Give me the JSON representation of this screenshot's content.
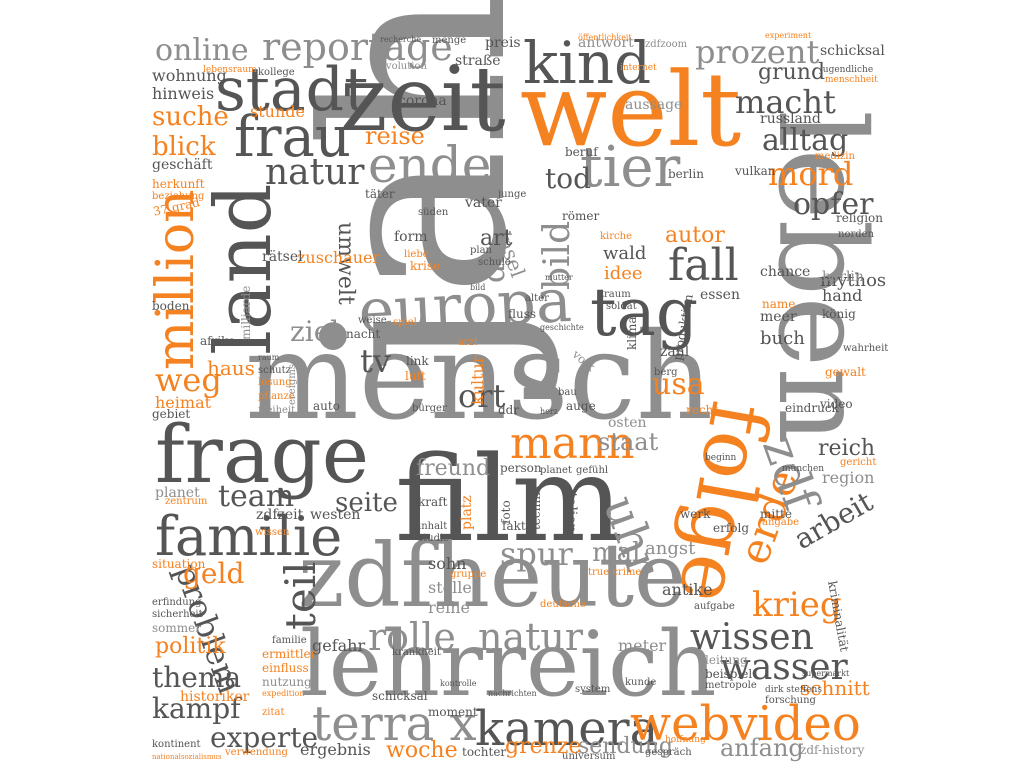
{
  "palette": {
    "dark": "#555555",
    "gray": "#8e8e8e",
    "orange": "#f58220",
    "light": "#a8a8a8"
  },
  "words": [
    {
      "text": "jahr",
      "color": "gray"
    },
    {
      "text": "leben",
      "color": "gray"
    },
    {
      "text": "mensch",
      "color": "gray"
    },
    {
      "text": "welt",
      "color": "orange"
    },
    {
      "text": "film",
      "color": "dark"
    },
    {
      "text": "zeit",
      "color": "dark"
    },
    {
      "text": "zdfheute",
      "color": "gray"
    },
    {
      "text": "lehrreich",
      "color": "gray"
    },
    {
      "text": "frage",
      "color": "dark"
    },
    {
      "text": "land",
      "color": "dark"
    },
    {
      "text": "folge",
      "color": "orange"
    },
    {
      "text": "europa",
      "color": "gray"
    },
    {
      "text": "tag",
      "color": "dark"
    },
    {
      "text": "kind",
      "color": "dark"
    },
    {
      "text": "stadt",
      "color": "dark"
    },
    {
      "text": "frau",
      "color": "dark"
    },
    {
      "text": "familie",
      "color": "dark"
    },
    {
      "text": "kamera",
      "color": "dark"
    },
    {
      "text": "webvideo",
      "color": "orange"
    },
    {
      "text": "terra x",
      "color": "gray"
    },
    {
      "text": "million",
      "color": "orange"
    },
    {
      "text": "ende",
      "color": "gray"
    },
    {
      "text": "tier",
      "color": "gray"
    },
    {
      "text": "reportage",
      "color": "gray"
    },
    {
      "text": "online",
      "color": "gray"
    },
    {
      "text": "prozent",
      "color": "gray"
    },
    {
      "text": "macht",
      "color": "dark"
    },
    {
      "text": "alltag",
      "color": "dark"
    },
    {
      "text": "mord",
      "color": "orange"
    },
    {
      "text": "natur",
      "color": "dark"
    },
    {
      "text": "reise",
      "color": "orange"
    },
    {
      "text": "tod",
      "color": "dark"
    },
    {
      "text": "opfer",
      "color": "dark"
    },
    {
      "text": "fall",
      "color": "dark"
    },
    {
      "text": "autor",
      "color": "orange"
    },
    {
      "text": "idee",
      "color": "orange"
    },
    {
      "text": "wald",
      "color": "dark"
    },
    {
      "text": "mythos",
      "color": "dark"
    },
    {
      "text": "teil",
      "color": "dark"
    },
    {
      "text": "problem",
      "color": "dark"
    },
    {
      "text": "geld",
      "color": "orange"
    },
    {
      "text": "team",
      "color": "dark"
    },
    {
      "text": "seite",
      "color": "dark"
    },
    {
      "text": "thema",
      "color": "dark"
    },
    {
      "text": "kampf",
      "color": "dark"
    },
    {
      "text": "experte",
      "color": "dark"
    },
    {
      "text": "rolle",
      "color": "gray"
    },
    {
      "text": "natur",
      "color": "gray"
    },
    {
      "text": "wissen",
      "color": "dark"
    },
    {
      "text": "wasser",
      "color": "dark"
    },
    {
      "text": "krieg",
      "color": "orange"
    },
    {
      "text": "arbeit",
      "color": "dark"
    },
    {
      "text": "erde",
      "color": "orange"
    },
    {
      "text": "spur",
      "color": "gray"
    },
    {
      "text": "mal",
      "color": "gray"
    },
    {
      "text": "mann",
      "color": "orange"
    },
    {
      "text": "usa",
      "color": "orange"
    },
    {
      "text": "weg",
      "color": "orange"
    },
    {
      "text": "grund",
      "color": "dark"
    },
    {
      "text": "zdf",
      "color": "gray"
    },
    {
      "text": "uhr",
      "color": "gray"
    },
    {
      "text": "schnitt",
      "color": "orange"
    },
    {
      "text": "woche",
      "color": "orange"
    },
    {
      "text": "grenze",
      "color": "orange"
    },
    {
      "text": "sendung",
      "color": "gray"
    },
    {
      "text": "anfang",
      "color": "gray"
    },
    {
      "text": "ergebnis",
      "color": "dark"
    },
    {
      "text": "suche",
      "color": "orange"
    },
    {
      "text": "blick",
      "color": "orange"
    },
    {
      "text": "ort",
      "color": "dark"
    },
    {
      "text": "bild",
      "color": "gray"
    },
    {
      "text": "tv",
      "color": "dark"
    },
    {
      "text": "dr",
      "color": "gray"
    },
    {
      "text": "insel",
      "color": "gray"
    },
    {
      "text": "art",
      "color": "dark"
    },
    {
      "text": "ziel",
      "color": "gray"
    },
    {
      "text": "umwelt",
      "color": "dark"
    },
    {
      "text": "freund",
      "color": "gray"
    },
    {
      "text": "staat",
      "color": "gray"
    },
    {
      "text": "reich",
      "color": "dark"
    },
    {
      "text": "region",
      "color": "gray"
    },
    {
      "text": "zuschauer",
      "color": "orange"
    },
    {
      "text": "heimat",
      "color": "orange"
    },
    {
      "text": "haus",
      "color": "orange"
    },
    {
      "text": "politik",
      "color": "orange"
    },
    {
      "text": "historiker",
      "color": "orange"
    },
    {
      "text": "ermittler",
      "color": "orange"
    },
    {
      "text": "einfluss",
      "color": "orange"
    },
    {
      "text": "wohnung",
      "color": "dark"
    },
    {
      "text": "hinweis",
      "color": "dark"
    },
    {
      "text": "geschäft",
      "color": "dark"
    },
    {
      "text": "herkunft",
      "color": "orange"
    },
    {
      "text": "beziehung",
      "color": "orange"
    },
    {
      "text": "37 grad",
      "color": "orange"
    },
    {
      "text": "rätsel",
      "color": "dark"
    },
    {
      "text": "boden",
      "color": "dark"
    },
    {
      "text": "afrika",
      "color": "dark"
    },
    {
      "text": "gebiet",
      "color": "dark"
    },
    {
      "text": "planet",
      "color": "gray"
    },
    {
      "text": "zdfzeit",
      "color": "dark"
    },
    {
      "text": "westen",
      "color": "dark"
    },
    {
      "text": "situation",
      "color": "orange"
    },
    {
      "text": "erfindung",
      "color": "dark"
    },
    {
      "text": "sicherheit",
      "color": "dark"
    },
    {
      "text": "sommer",
      "color": "gray"
    },
    {
      "text": "kontinent",
      "color": "dark"
    },
    {
      "text": "verwendung",
      "color": "orange"
    },
    {
      "text": "nationalsozialismus",
      "color": "orange"
    },
    {
      "text": "sohn",
      "color": "dark"
    },
    {
      "text": "stelle",
      "color": "gray"
    },
    {
      "text": "reihe",
      "color": "gray"
    },
    {
      "text": "gefahr",
      "color": "dark"
    },
    {
      "text": "familie",
      "color": "dark"
    },
    {
      "text": "nutzung",
      "color": "gray"
    },
    {
      "text": "schicksal",
      "color": "dark"
    },
    {
      "text": "moment",
      "color": "dark"
    },
    {
      "text": "tochter",
      "color": "dark"
    },
    {
      "text": "system",
      "color": "dark"
    },
    {
      "text": "kunde",
      "color": "dark"
    },
    {
      "text": "metropole",
      "color": "dark"
    },
    {
      "text": "beispiel",
      "color": "dark"
    },
    {
      "text": "leitung",
      "color": "gray"
    },
    {
      "text": "meter",
      "color": "gray"
    },
    {
      "text": "angst",
      "color": "gray"
    },
    {
      "text": "antike",
      "color": "dark"
    },
    {
      "text": "werk",
      "color": "dark"
    },
    {
      "text": "erfolg",
      "color": "dark"
    },
    {
      "text": "mitte",
      "color": "dark"
    },
    {
      "text": "aufgabe",
      "color": "dark"
    },
    {
      "text": "forschung",
      "color": "dark"
    },
    {
      "text": "gespräch",
      "color": "dark"
    },
    {
      "text": "universum",
      "color": "dark"
    },
    {
      "text": "zdf-history",
      "color": "gray"
    },
    {
      "text": "hoffnung",
      "color": "orange"
    },
    {
      "text": "kriminalität",
      "color": "dark"
    },
    {
      "text": "gericht",
      "color": "orange"
    },
    {
      "text": "angabe",
      "color": "orange"
    },
    {
      "text": "video",
      "color": "dark"
    },
    {
      "text": "eindruck",
      "color": "dark"
    },
    {
      "text": "gewalt",
      "color": "orange"
    },
    {
      "text": "wahrheit",
      "color": "dark"
    },
    {
      "text": "buch",
      "color": "dark"
    },
    {
      "text": "meer",
      "color": "dark"
    },
    {
      "text": "hand",
      "color": "dark"
    },
    {
      "text": "könig",
      "color": "dark"
    },
    {
      "text": "berlin",
      "color": "gray"
    },
    {
      "text": "chance",
      "color": "dark"
    },
    {
      "text": "name",
      "color": "orange"
    },
    {
      "text": "essen",
      "color": "dark"
    },
    {
      "text": "norden",
      "color": "dark"
    },
    {
      "text": "religion",
      "color": "dark"
    },
    {
      "text": "zahl",
      "color": "dark"
    },
    {
      "text": "klima",
      "color": "dark"
    },
    {
      "text": "recht",
      "color": "orange"
    },
    {
      "text": "berg",
      "color": "dark"
    },
    {
      "text": "volk",
      "color": "gray"
    },
    {
      "text": "produktion",
      "color": "dark"
    },
    {
      "text": "auto",
      "color": "dark"
    },
    {
      "text": "bürger",
      "color": "dark"
    },
    {
      "text": "auge",
      "color": "dark"
    },
    {
      "text": "ddr",
      "color": "dark"
    },
    {
      "text": "kultur",
      "color": "orange"
    },
    {
      "text": "luft",
      "color": "orange"
    },
    {
      "text": "ereignis",
      "color": "gray"
    },
    {
      "text": "freiheit",
      "color": "gray"
    },
    {
      "text": "lösung",
      "color": "orange"
    },
    {
      "text": "pflanze",
      "color": "orange"
    },
    {
      "text": "raum",
      "color": "dark"
    },
    {
      "text": "schutz",
      "color": "dark"
    },
    {
      "text": "link",
      "color": "dark"
    },
    {
      "text": "ozean",
      "color": "gray"
    },
    {
      "text": "milliarde",
      "color": "gray"
    },
    {
      "text": "nacht",
      "color": "dark"
    },
    {
      "text": "weise",
      "color": "dark"
    },
    {
      "text": "stunde",
      "color": "orange"
    },
    {
      "text": "russland",
      "color": "dark"
    },
    {
      "text": "corona",
      "color": "dark"
    },
    {
      "text": "straße",
      "color": "dark"
    },
    {
      "text": "preis",
      "color": "dark"
    },
    {
      "text": "antwort",
      "color": "gray"
    },
    {
      "text": "schicksal",
      "color": "dark"
    },
    {
      "text": "menge",
      "color": "dark"
    },
    {
      "text": "recherche",
      "color": "dark"
    },
    {
      "text": "evolution",
      "color": "gray"
    },
    {
      "text": "kollege",
      "color": "dark"
    },
    {
      "text": "zdfzoom",
      "color": "gray"
    },
    {
      "text": "öffentlichkeit",
      "color": "orange"
    },
    {
      "text": "experiment",
      "color": "orange"
    },
    {
      "text": "internet",
      "color": "orange"
    },
    {
      "text": "lebensraum",
      "color": "orange"
    },
    {
      "text": "jugendliche",
      "color": "dark"
    },
    {
      "text": "menschheit",
      "color": "orange"
    },
    {
      "text": "aussage",
      "color": "gray"
    },
    {
      "text": "beruf",
      "color": "dark"
    },
    {
      "text": "medizin",
      "color": "orange"
    },
    {
      "text": "vulkan",
      "color": "dark"
    },
    {
      "text": "berlin",
      "color": "dark"
    },
    {
      "text": "täter",
      "color": "dark"
    },
    {
      "text": "vater",
      "color": "dark"
    },
    {
      "text": "junge",
      "color": "dark"
    },
    {
      "text": "süden",
      "color": "dark"
    },
    {
      "text": "römer",
      "color": "dark"
    },
    {
      "text": "form",
      "color": "dark"
    },
    {
      "text": "plan",
      "color": "dark"
    },
    {
      "text": "kirche",
      "color": "orange"
    },
    {
      "text": "krise",
      "color": "orange"
    },
    {
      "text": "schule",
      "color": "dark"
    },
    {
      "text": "fluss",
      "color": "dark"
    },
    {
      "text": "soldat",
      "color": "dark"
    },
    {
      "text": "traum",
      "color": "dark"
    },
    {
      "text": "alter",
      "color": "dark"
    },
    {
      "text": "spiel",
      "color": "orange"
    },
    {
      "text": "arzt",
      "color": "orange"
    },
    {
      "text": "person",
      "color": "dark"
    },
    {
      "text": "planet",
      "color": "dark"
    },
    {
      "text": "gefühl",
      "color": "dark"
    },
    {
      "text": "osten",
      "color": "gray"
    },
    {
      "text": "münchen",
      "color": "dark"
    },
    {
      "text": "beginn",
      "color": "dark"
    },
    {
      "text": "kraft",
      "color": "dark"
    },
    {
      "text": "platz",
      "color": "orange"
    },
    {
      "text": "foto",
      "color": "dark"
    },
    {
      "text": "fakt",
      "color": "dark"
    },
    {
      "text": "technik",
      "color": "dark"
    },
    {
      "text": "italien",
      "color": "dark"
    },
    {
      "text": "wissen",
      "color": "orange"
    },
    {
      "text": "zentrum",
      "color": "orange"
    },
    {
      "text": "inhalt",
      "color": "dark"
    },
    {
      "text": "studie",
      "color": "dark"
    },
    {
      "text": "true crime",
      "color": "orange"
    },
    {
      "text": "gruppe",
      "color": "orange"
    },
    {
      "text": "deutsche",
      "color": "orange"
    },
    {
      "text": "expedition",
      "color": "orange"
    },
    {
      "text": "dirk steffens",
      "color": "dark"
    },
    {
      "text": "supermarkt",
      "color": "dark"
    },
    {
      "text": "krankheit",
      "color": "dark"
    },
    {
      "text": "kontrolle",
      "color": "dark"
    },
    {
      "text": "zitat",
      "color": "orange"
    },
    {
      "text": "nachrichten",
      "color": "dark"
    },
    {
      "text": "liebe",
      "color": "orange"
    },
    {
      "text": "mutter",
      "color": "dark"
    },
    {
      "text": "bild",
      "color": "dark"
    },
    {
      "text": "geschichte",
      "color": "dark"
    },
    {
      "text": "bau",
      "color": "dark"
    },
    {
      "text": "herz",
      "color": "dark"
    }
  ]
}
